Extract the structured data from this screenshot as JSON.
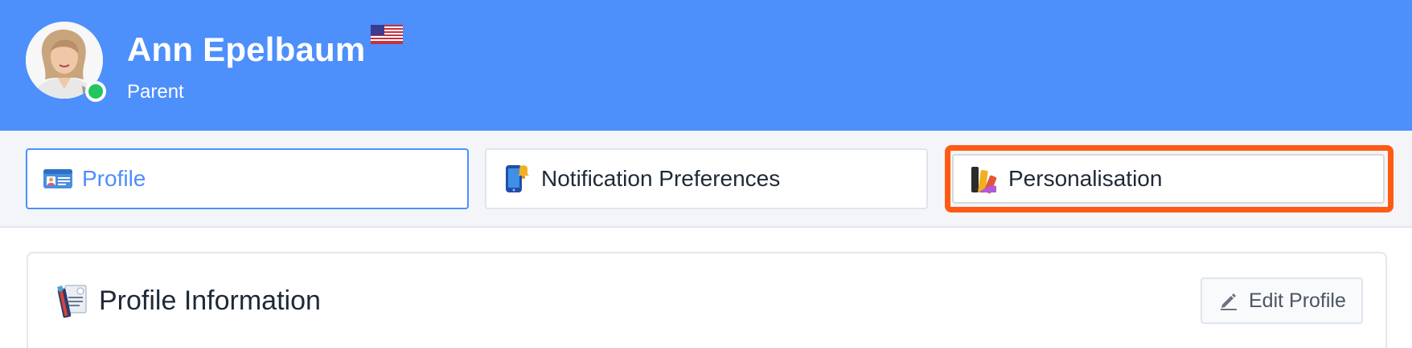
{
  "header": {
    "user_name": "Ann Epelbaum",
    "role": "Parent",
    "status": "online",
    "flag": "us-flag-icon",
    "background_color": "#4d8ffb",
    "status_color": "#22c55e"
  },
  "tabs": [
    {
      "label": "Profile",
      "icon": "id-card-icon",
      "active": true
    },
    {
      "label": "Notification Preferences",
      "icon": "phone-bell-icon",
      "active": false
    },
    {
      "label": "Personalisation",
      "icon": "color-swatches-icon",
      "active": false,
      "highlighted": true
    }
  ],
  "highlight_color": "#ff5a14",
  "card": {
    "title": "Profile Information",
    "icon": "profile-documents-icon",
    "edit_button_label": "Edit Profile",
    "edit_button_icon": "pencil-icon"
  }
}
